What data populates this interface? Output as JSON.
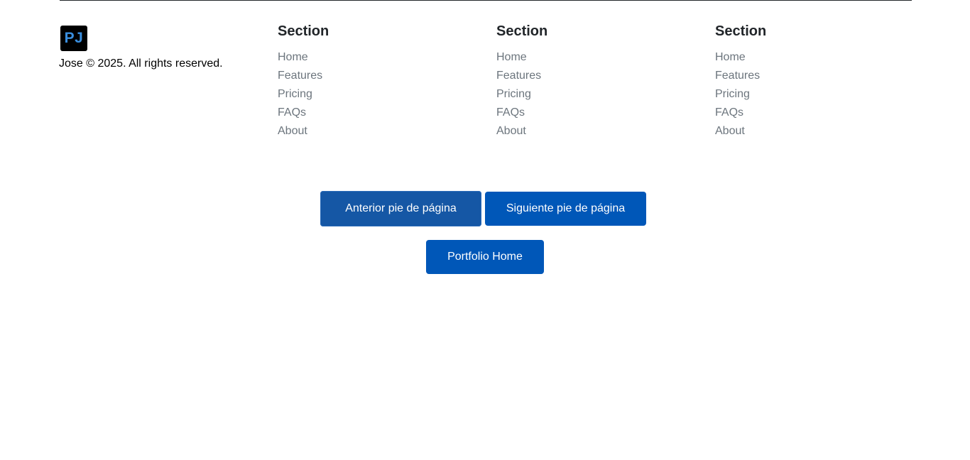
{
  "brand": {
    "logo_text": "PJ",
    "copyright": "Jose © 2025. All rights reserved."
  },
  "sections": [
    {
      "title": "Section",
      "links": [
        "Home",
        "Features",
        "Pricing",
        "FAQs",
        "About"
      ]
    },
    {
      "title": "Section",
      "links": [
        "Home",
        "Features",
        "Pricing",
        "FAQs",
        "About"
      ]
    },
    {
      "title": "Section",
      "links": [
        "Home",
        "Features",
        "Pricing",
        "FAQs",
        "About"
      ]
    }
  ],
  "navigation": {
    "prev_label": "Anterior pie de página",
    "next_label": "Siguiente pie de página",
    "home_label": "Portfolio Home"
  },
  "colors": {
    "button_primary": "#0057b8",
    "link_muted": "#6c757d",
    "logo_text": "#3a8fe0"
  }
}
